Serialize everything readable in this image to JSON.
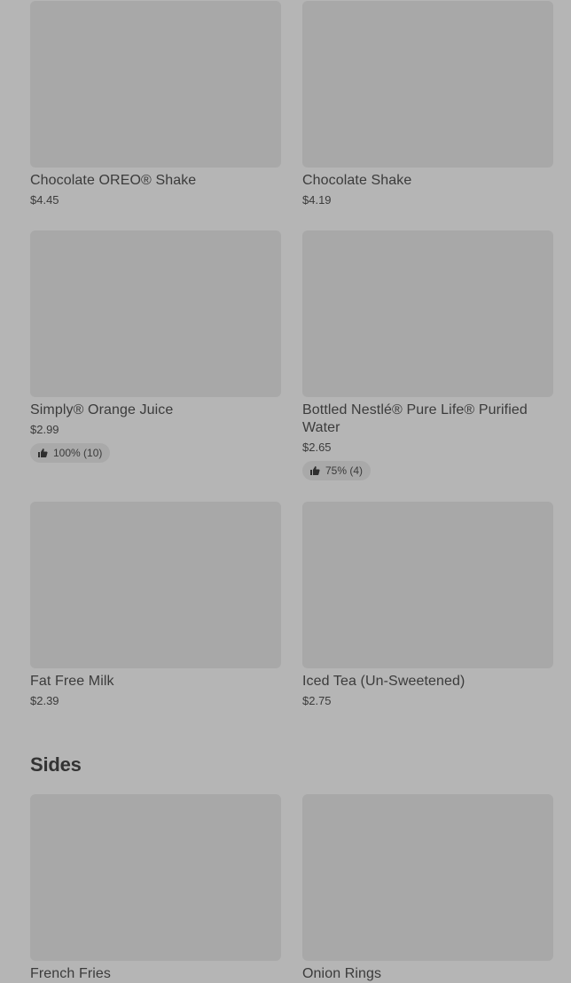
{
  "drinks": [
    {
      "name": "Chocolate OREO® Shake",
      "price": "$4.45"
    },
    {
      "name": "Chocolate Shake",
      "price": "$4.19"
    },
    {
      "name": "Simply® Orange Juice",
      "price": "$2.99",
      "rating": "100% (10)"
    },
    {
      "name": "Bottled Nestlé® Pure Life® Purified Water",
      "price": "$2.65",
      "rating": "75% (4)"
    },
    {
      "name": "Fat Free Milk",
      "price": "$2.39"
    },
    {
      "name": "Iced Tea (Un-Sweetened)",
      "price": "$2.75"
    }
  ],
  "sides": {
    "title": "Sides",
    "items": [
      {
        "name": "French Fries"
      },
      {
        "name": "Onion Rings"
      }
    ]
  },
  "icons": {
    "rating": "thumbs-up-icon"
  }
}
